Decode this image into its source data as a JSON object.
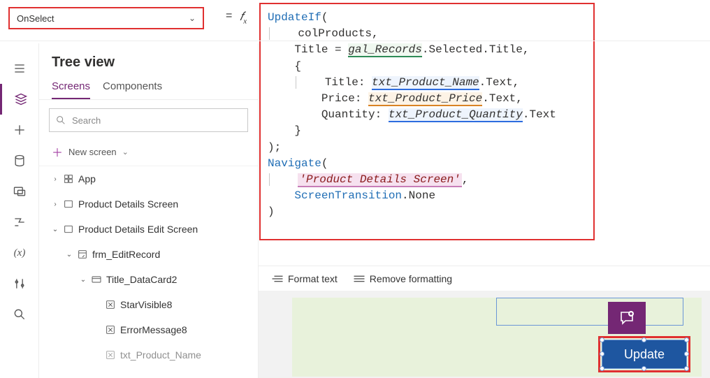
{
  "property_dropdown": {
    "value": "OnSelect"
  },
  "formula_bar": {
    "equals": "=",
    "fx": "fx"
  },
  "formula": {
    "fn_updateif": "UpdateIf",
    "collection": "colProducts",
    "cond_field": "Title",
    "eq": " = ",
    "gal": "gal_Records",
    "gal_tail": ".Selected.Title",
    "lbrace": "{",
    "k_title": "Title:",
    "v_title": "txt_Product_Name",
    "v_title_tail": ".Text",
    "k_price": "Price:",
    "v_price": "txt_Product_Price",
    "v_price_tail": ".Text",
    "k_qty": "Quantity:",
    "v_qty": "txt_Product_Quantity",
    "v_qty_tail": ".Text",
    "rbrace": "}",
    "semicolon": ");",
    "fn_nav": "Navigate",
    "screen": "'Product Details Screen'",
    "trans_obj": "ScreenTransition",
    "trans_prop": ".None",
    "close": ")"
  },
  "tree": {
    "title": "Tree view",
    "tab_screens": "Screens",
    "tab_components": "Components",
    "search_placeholder": "Search",
    "new_screen": "New screen",
    "items": [
      {
        "indent": 1,
        "caret": "›",
        "icon": "app",
        "label": "App"
      },
      {
        "indent": 1,
        "caret": "›",
        "icon": "screen",
        "label": "Product Details Screen"
      },
      {
        "indent": 1,
        "caret": "⌄",
        "icon": "screen",
        "label": "Product Details Edit Screen"
      },
      {
        "indent": 2,
        "caret": "⌄",
        "icon": "form",
        "label": "frm_EditRecord"
      },
      {
        "indent": 3,
        "caret": "⌄",
        "icon": "card",
        "label": "Title_DataCard2"
      },
      {
        "indent": 4,
        "caret": "",
        "icon": "ctrl",
        "label": "StarVisible8"
      },
      {
        "indent": 4,
        "caret": "",
        "icon": "ctrl",
        "label": "ErrorMessage8"
      },
      {
        "indent": 4,
        "caret": "",
        "icon": "ctrl",
        "label": "txt_Product_Name"
      }
    ]
  },
  "footer": {
    "format": "Format text",
    "remove": "Remove formatting"
  },
  "canvas": {
    "button_label": "Update"
  }
}
